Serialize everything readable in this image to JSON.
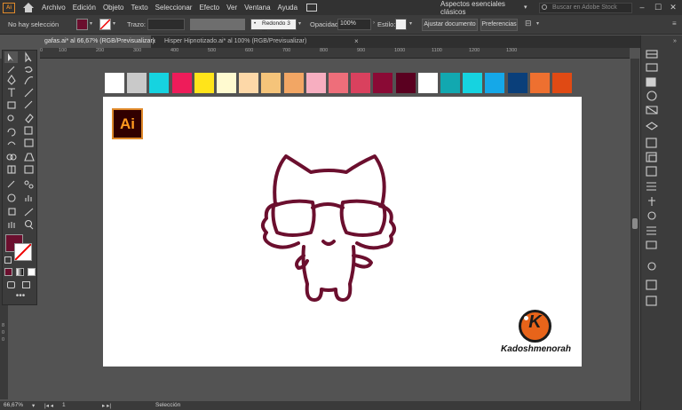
{
  "menubar": {
    "app_logo": "Ai",
    "items": [
      "Archivo",
      "Edición",
      "Objeto",
      "Texto",
      "Seleccionar",
      "Efecto",
      "Ver",
      "Ventana",
      "Ayuda"
    ],
    "workspace": "Aspectos esenciales clásicos",
    "search_placeholder": "Buscar en Adobe Stock",
    "window_buttons": [
      "–",
      "☐",
      "✕"
    ]
  },
  "controlbar": {
    "selection_label": "No hay selección",
    "stroke_label": "Trazo:",
    "brush_label": "Redondo 3 ...",
    "opacity_label": "Opacidad:",
    "opacity_value": "100%",
    "style_label": "Estilo:",
    "align_button": "Ajustar documento",
    "prefs_button": "Preferencias",
    "fill_color": "#6b0f2e"
  },
  "tabs": [
    {
      "label": "gafas.ai* al 66,67% (RGB/Previsualizar)",
      "active": true
    },
    {
      "label": "Hisper Hipnotizado.ai* al 100% (RGB/Previsualizar)",
      "active": false
    }
  ],
  "ruler_ticks": [
    "0",
    "100",
    "200",
    "300",
    "400",
    "500",
    "600",
    "700",
    "800",
    "900",
    "1000",
    "1100",
    "1200",
    "1300"
  ],
  "left_ruler_ticks": [
    "8",
    "0",
    "0"
  ],
  "swatches": [
    "#ffffff",
    "#c9c9c9",
    "#16d3e0",
    "#ee1c5a",
    "#ffe41a",
    "#fffad0",
    "#fdd8a8",
    "#f5c47a",
    "#f2a664",
    "#f7aec0",
    "#ee6e7a",
    "#d9415e",
    "#8a0a35",
    "#5a0020",
    "#ffffff",
    "#12a8b0",
    "#16d3e0",
    "#15a8e8",
    "#0a3f7a",
    "#ee7030",
    "#e04a14"
  ],
  "artboard": {
    "badge_text": "Ai",
    "brand_text": "Kadoshmenorah",
    "logo_letter": "K",
    "drawing_color": "#6b0f2e"
  },
  "statusbar": {
    "zoom": "66,67%",
    "page": "1",
    "tool": "Selección"
  },
  "icons": {
    "toolbar": [
      "selection-tool",
      "direct-selection-tool",
      "magic-wand-tool",
      "lasso-tool",
      "pen-tool",
      "curvature-tool",
      "type-tool",
      "line-tool",
      "rectangle-tool",
      "paintbrush-tool",
      "shaper-tool",
      "eraser-tool",
      "rotate-tool",
      "scale-tool",
      "width-tool",
      "free-transform-tool",
      "shape-builder-tool",
      "perspective-tool",
      "mesh-tool",
      "gradient-tool",
      "eyedropper-tool",
      "blend-tool",
      "symbol-sprayer-tool",
      "column-graph-tool",
      "artboard-tool",
      "slice-tool",
      "hand-tool",
      "zoom-tool"
    ]
  }
}
